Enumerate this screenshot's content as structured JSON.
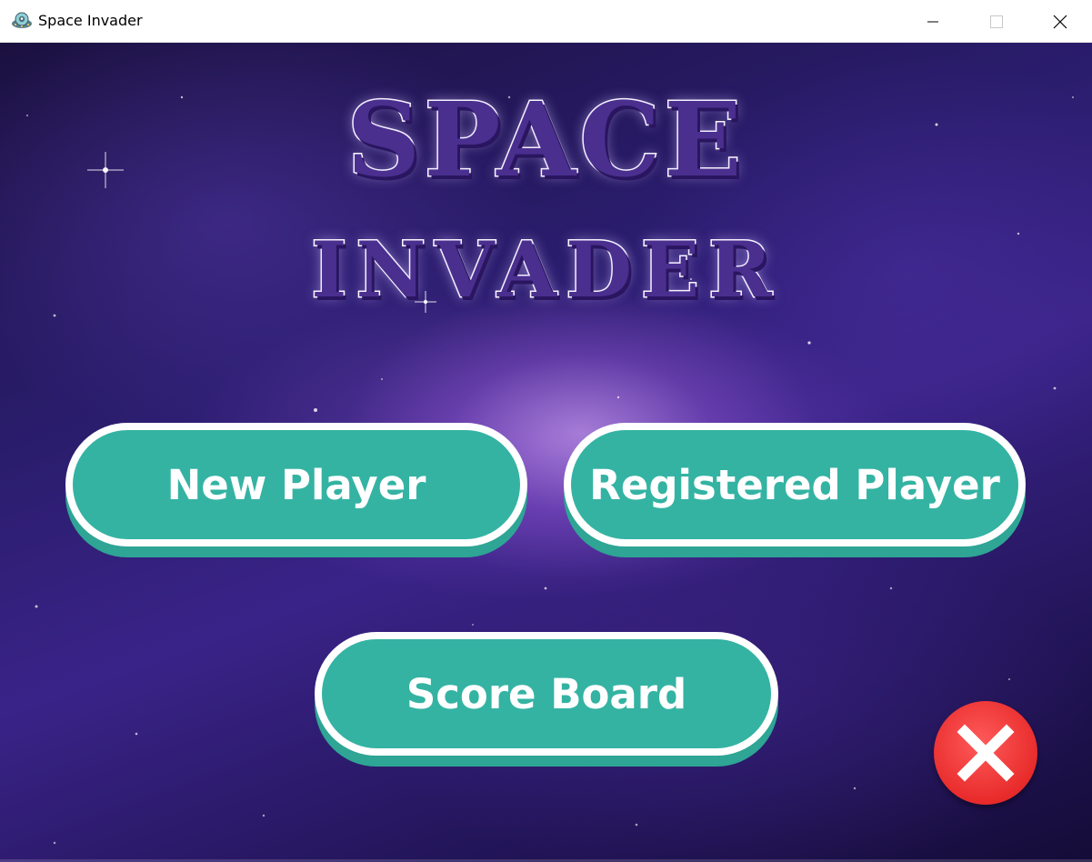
{
  "window": {
    "title": "Space Invader",
    "app_icon": "alien-ufo-icon",
    "controls": [
      "minimize-icon",
      "maximize-icon",
      "close-icon"
    ]
  },
  "game": {
    "title_line1": "SPACE",
    "title_line2": "INVADER",
    "background": "purple-galaxy-starfield",
    "buttons": {
      "new_player": "New Player",
      "registered_player": "Registered Player",
      "score_board": "Score Board"
    },
    "exit_icon": "red-x-icon"
  },
  "colors": {
    "button_fill": "#34b3a3",
    "button_border": "#ffffff",
    "title_fill": "#4a2f8f",
    "exit_red": "#e82b2b"
  }
}
